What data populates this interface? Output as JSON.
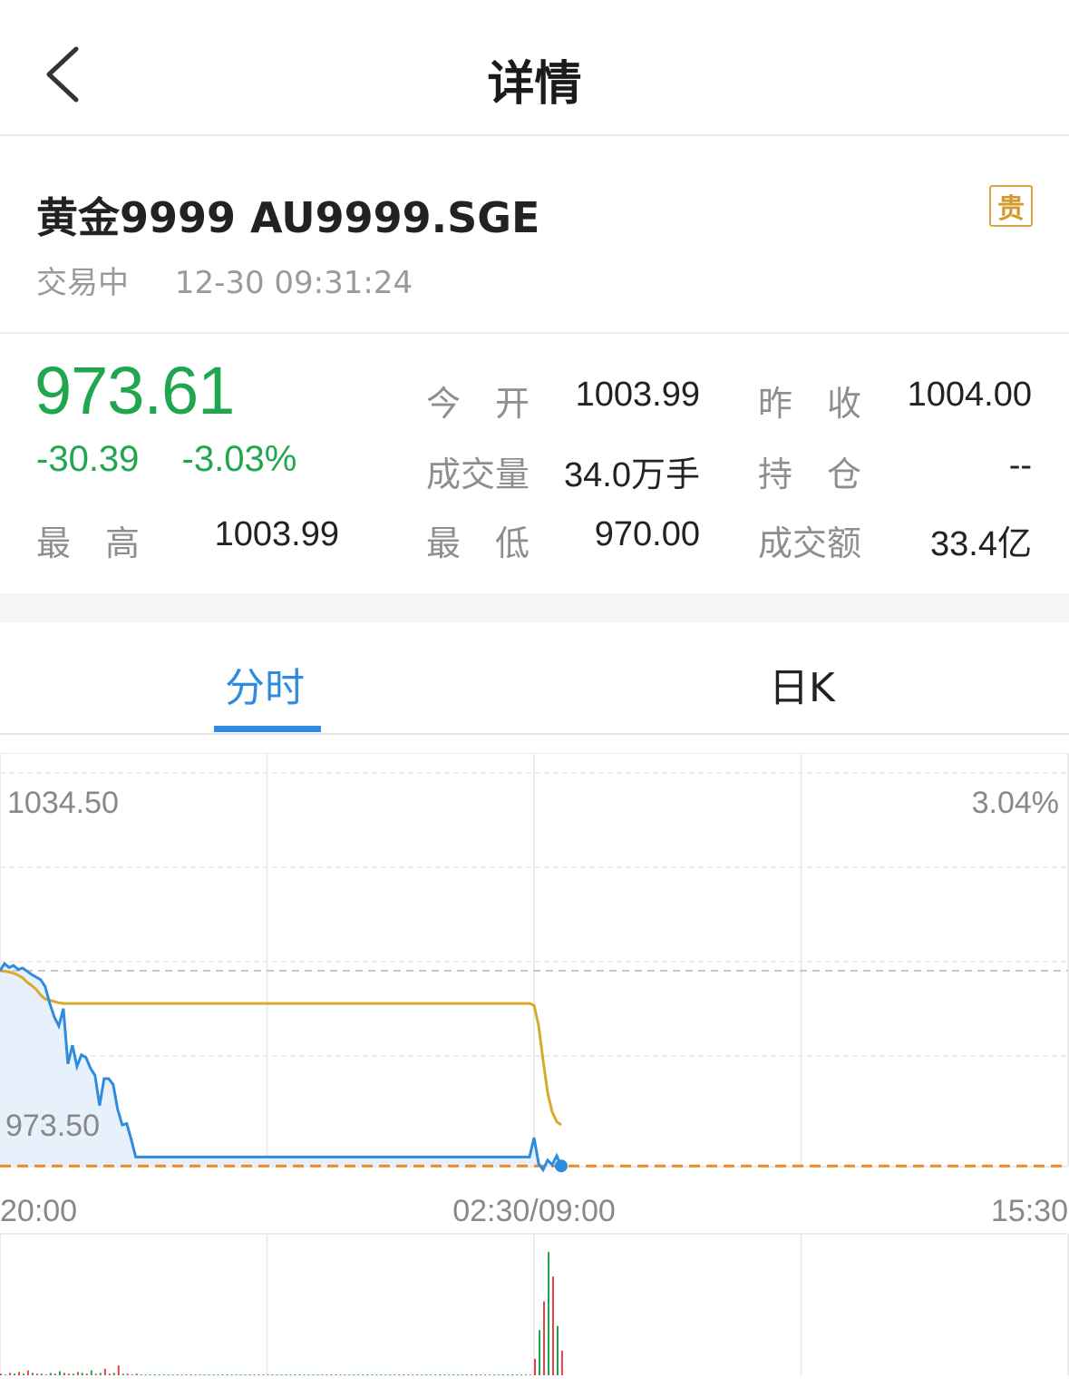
{
  "nav": {
    "title": "详情"
  },
  "header": {
    "name": "黄金9999 AU9999.SGE",
    "status": "交易中",
    "time": "12-30 09:31:24",
    "badge": "贵"
  },
  "quote": {
    "price": "973.61",
    "change": "-30.39",
    "change_pct": "-3.03%",
    "stats": [
      {
        "label": "今　开",
        "value": "1003.99"
      },
      {
        "label": "昨　收",
        "value": "1004.00"
      },
      {
        "label": "成交量",
        "value": "34.0万手"
      },
      {
        "label": "持　仓",
        "value": "--"
      },
      {
        "label": "最　高",
        "value": "1003.99"
      },
      {
        "label": "最　低",
        "value": "970.00"
      },
      {
        "label": "成交额",
        "value": "33.4亿"
      }
    ]
  },
  "tabs": [
    {
      "label": "分时",
      "active": true
    },
    {
      "label": "日K",
      "active": false
    }
  ],
  "colors": {
    "up": "#e8414a",
    "down": "#21a650",
    "accent": "#2f8be0",
    "avg_line": "#d9a92b",
    "ref_line": "#f08a24"
  },
  "chart_data": {
    "type": "line",
    "y_top_label": "1034.50",
    "y_bottom_label": "973.50",
    "right_top_label": "3.04%",
    "x_labels": [
      "20:00",
      "02:30/09:00",
      "15:30"
    ],
    "ylim": [
      973.5,
      1034.5
    ],
    "series": [
      {
        "values": [
          1004.0,
          1005.1,
          1004.5,
          1004.8,
          1004.2,
          1004.4,
          1003.9,
          1003.4,
          1003.0,
          1002.6,
          1001.5,
          998.9,
          996.8,
          995.4,
          998.1,
          989.5,
          992.4,
          989.1,
          990.9,
          990.5,
          988.8,
          987.7,
          983.0,
          987.2,
          987.2,
          986.3,
          982.4,
          980.0,
          980.2,
          977.7,
          975.0,
          975.0,
          975.0,
          975.0,
          975.0,
          975.0,
          975.0,
          975.0,
          975.0,
          975.0,
          975.0,
          975.0,
          975.0,
          975.0,
          975.0,
          975.0,
          975.0,
          975.0,
          975.0,
          975.0,
          975.0,
          975.0,
          975.0,
          975.0,
          975.0,
          975.0,
          975.0,
          975.0,
          975.0,
          975.0,
          975.0,
          975.0,
          975.0,
          975.0,
          975.0,
          975.0,
          975.0,
          975.0,
          975.0,
          975.0,
          975.0,
          975.0,
          975.0,
          975.0,
          975.0,
          975.0,
          975.0,
          975.0,
          975.0,
          975.0,
          975.0,
          975.0,
          975.0,
          975.0,
          975.0,
          975.0,
          975.0,
          975.0,
          975.0,
          975.0,
          975.0,
          975.0,
          975.0,
          975.0,
          975.0,
          975.0,
          975.0,
          975.0,
          975.0,
          975.0,
          975.0,
          975.0,
          975.0,
          975.0,
          975.0,
          975.0,
          975.0,
          975.0,
          975.0,
          975.0,
          975.0,
          975.0,
          975.0,
          975.0,
          975.0,
          975.0,
          975.0,
          975.0,
          978.0,
          974.0,
          973.0,
          974.5,
          973.8,
          975.2,
          973.61
        ]
      },
      {
        "values": [
          1004.0,
          1003.9,
          1003.8,
          1003.6,
          1003.3,
          1002.9,
          1002.2,
          1001.7,
          1001.1,
          1000.2,
          999.6,
          999.4,
          999.2,
          999.0,
          998.9,
          998.9,
          998.9,
          998.9,
          998.9,
          998.9,
          998.9,
          998.9,
          998.9,
          998.9,
          998.9,
          998.9,
          998.9,
          998.9,
          998.9,
          998.9,
          998.9,
          998.9,
          998.9,
          998.9,
          998.9,
          998.9,
          998.9,
          998.9,
          998.9,
          998.9,
          998.9,
          998.9,
          998.9,
          998.9,
          998.9,
          998.9,
          998.9,
          998.9,
          998.9,
          998.9,
          998.9,
          998.9,
          998.9,
          998.9,
          998.9,
          998.9,
          998.9,
          998.9,
          998.9,
          998.9,
          998.9,
          998.9,
          998.9,
          998.9,
          998.9,
          998.9,
          998.9,
          998.9,
          998.9,
          998.9,
          998.9,
          998.9,
          998.9,
          998.9,
          998.9,
          998.9,
          998.9,
          998.9,
          998.9,
          998.9,
          998.9,
          998.9,
          998.9,
          998.9,
          998.9,
          998.9,
          998.9,
          998.9,
          998.9,
          998.9,
          998.9,
          998.9,
          998.9,
          998.9,
          998.9,
          998.9,
          998.9,
          998.9,
          998.9,
          998.9,
          998.9,
          998.9,
          998.9,
          998.9,
          998.9,
          998.9,
          998.9,
          998.9,
          998.9,
          998.9,
          998.9,
          998.9,
          998.9,
          998.9,
          998.9,
          998.9,
          998.9,
          998.9,
          998.6,
          995.5,
          990.0,
          985.0,
          982.0,
          980.5,
          980.0
        ]
      }
    ],
    "reference_levels": {
      "prev_close": 1004.0,
      "current": 973.61
    },
    "volume": [
      2,
      1,
      3,
      2,
      4,
      2,
      6,
      3,
      2,
      2,
      1,
      3,
      2,
      5,
      3,
      2,
      2,
      4,
      3,
      2,
      6,
      2,
      3,
      8,
      2,
      3,
      12,
      2,
      2,
      1,
      2,
      1,
      1,
      1,
      1,
      1,
      1,
      1,
      1,
      1,
      1,
      1,
      1,
      1,
      1,
      1,
      1,
      1,
      1,
      1,
      1,
      1,
      1,
      1,
      1,
      1,
      1,
      1,
      1,
      1,
      1,
      1,
      1,
      1,
      1,
      1,
      1,
      1,
      1,
      1,
      1,
      1,
      1,
      1,
      1,
      1,
      1,
      1,
      1,
      1,
      1,
      1,
      1,
      1,
      1,
      1,
      1,
      1,
      1,
      1,
      1,
      1,
      1,
      1,
      1,
      1,
      1,
      1,
      1,
      1,
      1,
      1,
      1,
      1,
      1,
      1,
      1,
      1,
      1,
      1,
      1,
      1,
      1,
      1,
      1,
      1,
      1,
      1,
      20,
      55,
      90,
      150,
      120,
      60,
      30
    ],
    "volume_up": [
      true,
      false,
      true,
      false,
      true,
      false,
      true,
      false,
      true,
      false,
      true,
      false,
      true,
      false,
      true,
      true,
      false,
      true,
      false,
      true,
      false,
      true,
      false,
      true,
      true,
      false,
      true,
      false,
      true,
      false,
      true,
      false,
      false,
      false,
      false,
      false,
      false,
      false,
      false,
      false,
      false,
      false,
      false,
      false,
      false,
      false,
      false,
      false,
      false,
      false,
      false,
      false,
      false,
      false,
      false,
      false,
      false,
      false,
      false,
      false,
      false,
      false,
      false,
      false,
      false,
      false,
      false,
      false,
      false,
      false,
      false,
      false,
      false,
      false,
      false,
      false,
      false,
      false,
      false,
      false,
      false,
      false,
      false,
      false,
      false,
      false,
      false,
      false,
      false,
      false,
      false,
      false,
      false,
      false,
      false,
      false,
      false,
      false,
      false,
      false,
      false,
      false,
      false,
      false,
      false,
      false,
      false,
      false,
      false,
      false,
      false,
      false,
      false,
      false,
      false,
      false,
      false,
      false,
      true,
      false,
      true,
      false,
      true,
      false,
      true
    ]
  }
}
